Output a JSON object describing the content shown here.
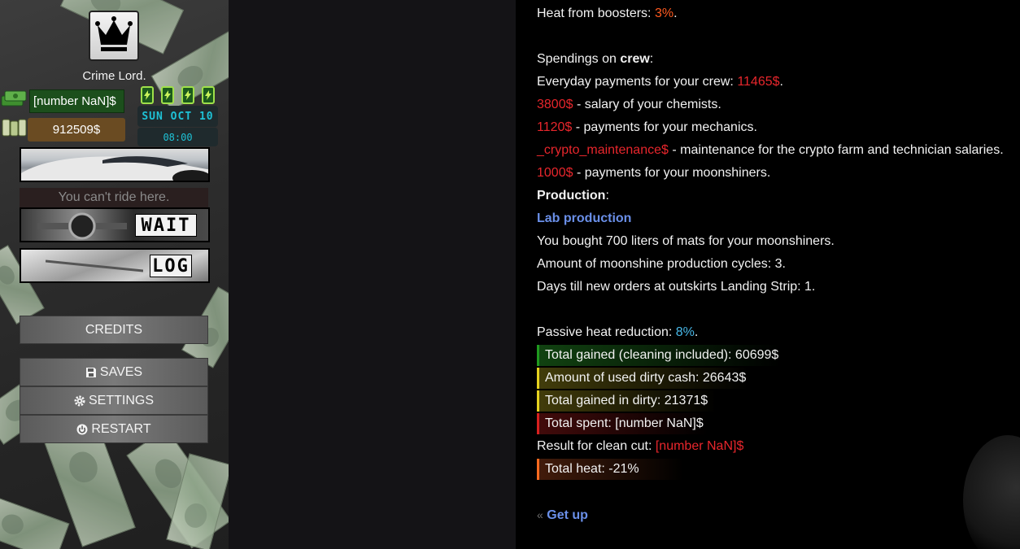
{
  "sidebar": {
    "rank": "Crime Lord.",
    "clean_money": "[number NaN]$",
    "dirty_money": "912509$",
    "date": "SUN OCT 10",
    "time": "08:00",
    "ride_message": "You can't ride here.",
    "wait_label": "WAIT",
    "log_label": "LOG",
    "menu": {
      "credits": "CREDITS",
      "saves": "SAVES",
      "settings": "SETTINGS",
      "restart": "RESTART"
    }
  },
  "report": {
    "heat_boosters_label": "Heat from boosters: ",
    "heat_boosters_value": "3%",
    "crew_prefix": "Spendings on ",
    "crew_word": "crew",
    "crew_suffix": ":",
    "everyday_label": "Everyday payments for your crew: ",
    "everyday_value": "11465$",
    "chemists_value": "3800$",
    "chemists_label": " - salary of your chemists.",
    "mechanics_value": "1120$",
    "mechanics_label": " - payments for your mechanics.",
    "crypto_value": "_crypto_maintenance$",
    "crypto_label": " - maintenance for the crypto farm and technician salaries.",
    "moonshiners_value": "1000$",
    "moonshiners_label": " - payments for your moonshiners.",
    "production_word": "Production",
    "production_suffix": ":",
    "lab_production": "Lab production",
    "mats_line": "You bought 700 liters of mats for your moonshiners.",
    "cycles_line": "Amount of moonshine production cycles: 3.",
    "orders_line": "Days till new orders at outskirts Landing Strip: 1.",
    "passive_label": "Passive heat reduction: ",
    "passive_value": "8%",
    "total_gained": "Total gained (cleaning included): 60699$",
    "used_dirty": "Amount of used dirty cash: 26643$",
    "gained_dirty": "Total gained in dirty: 21371$",
    "total_spent": "Total spent: [number NaN]$",
    "clean_cut_label": "Result for clean cut: ",
    "clean_cut_value": "[number NaN]$",
    "total_heat": "Total heat: -21%",
    "get_up": "Get up"
  },
  "colors": {
    "red": "#e8262c",
    "orange": "#ff5a1f",
    "blue": "#48b8e8",
    "link": "#6a8fe8",
    "date_text": "#1fc2d6"
  },
  "icons": [
    "crown-icon",
    "money-stack-icon",
    "energy-can-icon",
    "floppy-disk-icon",
    "gear-icon",
    "power-icon",
    "double-chevron-left-icon"
  ]
}
